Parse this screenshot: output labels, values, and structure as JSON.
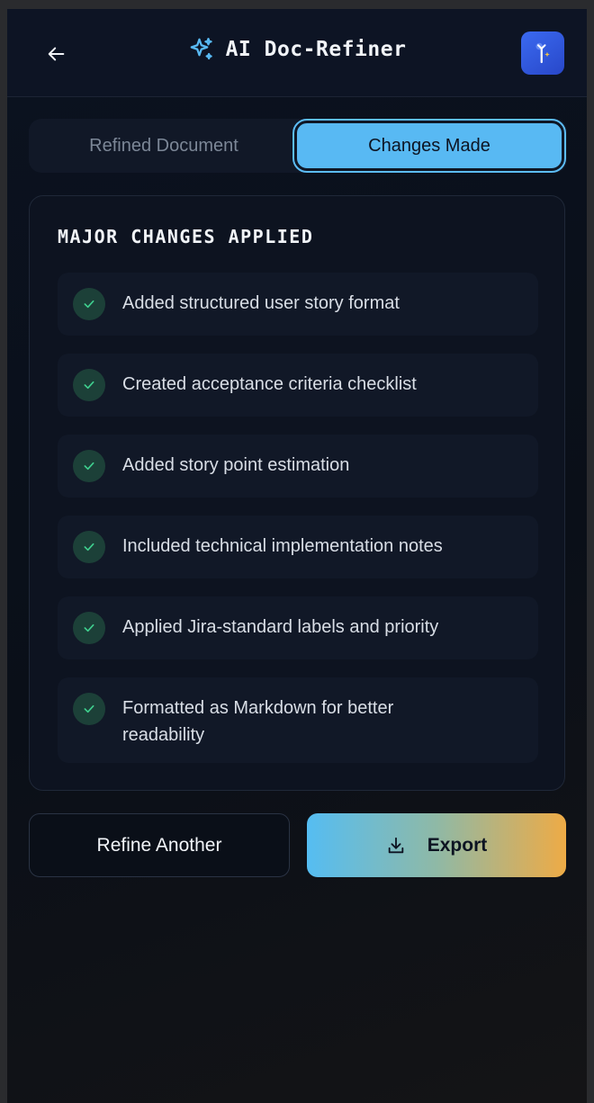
{
  "header": {
    "title": "AI Doc-Refiner",
    "back_icon": "arrow-left-icon",
    "title_icon": "sparkles-icon",
    "avatar_icon": "magic-wand-icon"
  },
  "tabs": [
    {
      "label": "Refined Document",
      "active": false
    },
    {
      "label": "Changes Made",
      "active": true
    }
  ],
  "changes": {
    "heading": "MAJOR CHANGES APPLIED",
    "items": [
      "Added structured user story format",
      "Created acceptance criteria checklist",
      "Added story point estimation",
      "Included technical implementation notes",
      "Applied Jira-standard labels and priority",
      "Formatted as Markdown for better readability"
    ]
  },
  "actions": {
    "refine_label": "Refine Another",
    "export_label": "Export",
    "export_icon": "download-icon"
  },
  "colors": {
    "accent": "#58b9f3",
    "check_green": "#3fcf8e",
    "export_gradient_start": "#55bdf2",
    "export_gradient_end": "#eeab46",
    "avatar": "#3b6af0"
  }
}
